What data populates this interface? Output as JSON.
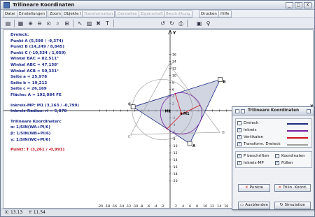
{
  "app": {
    "title": "Trilineare Koordinaten",
    "window_buttons": [
      "_",
      "□",
      "X"
    ]
  },
  "menu": [
    {
      "label": "Datei",
      "enabled": true
    },
    {
      "label": "Einstellungen",
      "enabled": true
    },
    {
      "label": "Zoom",
      "enabled": true
    },
    {
      "label": "Objekte I",
      "enabled": true
    },
    {
      "label": "Transformation",
      "enabled": false
    },
    {
      "label": "Darstellen",
      "enabled": false
    },
    {
      "label": "Eigenschaft",
      "enabled": false
    },
    {
      "label": "Beschriftung",
      "enabled": false
    },
    {
      "label": "Drucken",
      "enabled": true
    },
    {
      "label": "Hilfe",
      "enabled": true
    }
  ],
  "toolbar": {
    "icons": [
      "clipboard-icon",
      "grid-icon",
      "zoom-in-icon",
      "zoom-out-icon",
      "zoom-fit-icon",
      "zoom-area-icon",
      "zoom-window-icon",
      "arrow-icon",
      "fill-icon",
      "trash-icon",
      "text-icon",
      "undo-icon",
      "redo-icon",
      "print-icon",
      "lock-icon",
      "key-icon"
    ]
  },
  "info": {
    "heading": "Dreieck:",
    "lines": [
      "Punkt A (5,598 / -9,374)",
      "Punkt B (14,249 / 8,845)",
      "Punkt C (-10,534 / 1,059)",
      "Winkel BAC = 82,511°",
      "Winkel ABC = 47,158°",
      "Winkel ACB = 50,331°",
      "Seite a = 25,978",
      "Seite b = 19,212",
      "Seite c = 26,169",
      "Fläche: A = 192,084 FE"
    ],
    "incircle": [
      "Inkreis-MP: M1 (3,163 / -0,799)",
      "Inkreis-Radius: ri = 5,878"
    ],
    "tril_heading": "Trilineare Koordinaten:",
    "tril_lines": [
      "α: 1/SIN(WA+PI/6)",
      "β: 1/SIN(WB+PI/6)",
      "γ: 1/SIN(WC+PI/6)"
    ],
    "point_t": "Punkt: T (3,261 / -0,991)"
  },
  "plot": {
    "x_axis_label": "X",
    "y_axis_label": "Y",
    "x_ticks": [
      "-20",
      "-18",
      "-16",
      "-14",
      "-12",
      "-10",
      "-8",
      "-6",
      "-4",
      "-2",
      "0",
      "2",
      "4",
      "6",
      "8",
      "10",
      "12",
      "14",
      "16",
      "18",
      "20",
      "22"
    ],
    "y_ticks": [
      "16",
      "14",
      "12",
      "10",
      "8",
      "6",
      "4",
      "2",
      "-2",
      "-4",
      "-6",
      "-8",
      "-10",
      "-12",
      "-14",
      "-16",
      "-18",
      "-20"
    ],
    "point_labels": {
      "A": "A",
      "B": "B",
      "C": "C",
      "M1": "M1",
      "M2": "M2",
      "A_prime": "A'",
      "B_prime": "B'",
      "C_prime": "C'",
      "T": "T"
    },
    "colors": {
      "triangle_fill": "#a9b3c9",
      "triangle_stroke": "#1f2a86",
      "incircle": "#7a1fa0",
      "altitudes": "#d0101a",
      "transform_triangle": "#a0a0a0",
      "axis": "#000000"
    }
  },
  "panel": {
    "title": "Trilineare Koordinaten",
    "title_buttons": [
      "-",
      "□",
      "x"
    ],
    "rows": [
      {
        "label": "Dreieck",
        "checked": false,
        "color": "#1f2a86"
      },
      {
        "label": "Inkreis",
        "checked": true,
        "color": "#7a1fa0"
      },
      {
        "label": "Vertikalen",
        "checked": true,
        "color": "#d0101a"
      },
      {
        "label": "Transform. Dreieck",
        "checked": true,
        "color": "#a0a0a0"
      }
    ],
    "options": [
      {
        "label": "P beschriften",
        "checked": true
      },
      {
        "label": "Koordinaten",
        "checked": false
      },
      {
        "label": "Inkreis-MP",
        "checked": true
      },
      {
        "label": "Füllen",
        "checked": true
      }
    ],
    "buttons": {
      "punkte": "Punkte",
      "trilin_koord": "Trilin. Koord.",
      "ausblenden": "Ausblenden",
      "simulation": "Simulation"
    }
  },
  "status": {
    "x": "X: 13.13",
    "y": "Y: 11.54"
  }
}
